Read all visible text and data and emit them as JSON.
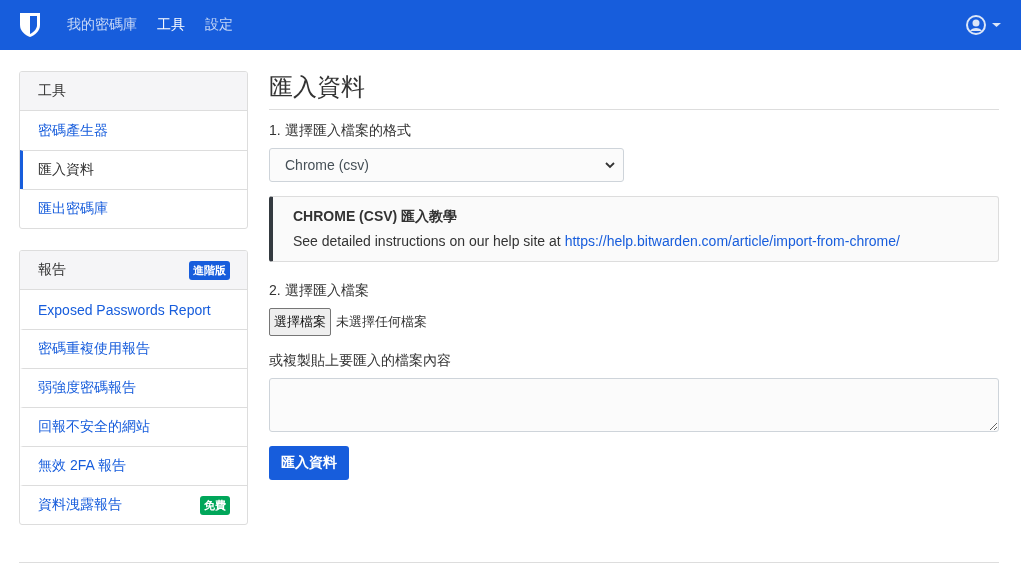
{
  "navbar": {
    "items": [
      {
        "label": "我的密碼庫",
        "selected": false
      },
      {
        "label": "工具",
        "selected": true
      },
      {
        "label": "設定",
        "selected": false
      }
    ]
  },
  "sidebar": [
    {
      "title": "工具",
      "items": [
        {
          "label": "密碼產生器",
          "selected": false
        },
        {
          "label": "匯入資料",
          "selected": true
        },
        {
          "label": "匯出密碼庫",
          "selected": false
        }
      ]
    },
    {
      "title": "報告",
      "badge": {
        "label": "進階版",
        "color": "#175ddc"
      },
      "items": [
        {
          "label": "Exposed Passwords Report",
          "selected": false
        },
        {
          "label": "密碼重複使用報告",
          "selected": false
        },
        {
          "label": "弱強度密碼報告",
          "selected": false
        },
        {
          "label": "回報不安全的網站",
          "selected": false
        },
        {
          "label": "無效 2FA 報告",
          "selected": false
        },
        {
          "label": "資料洩露報告",
          "selected": false,
          "badge": {
            "label": "免費",
            "color": "#00a65a"
          }
        }
      ]
    }
  ],
  "main": {
    "title": "匯入資料",
    "format_label": "1. 選擇匯入檔案的格式",
    "format_value": "Chrome (csv)",
    "callout": {
      "title": "CHROME (CSV) 匯入教學",
      "text": "See detailed instructions on our help site at",
      "link": "https://help.bitwarden.com/article/import-from-chrome/"
    },
    "file_label": "2. 選擇匯入檔案",
    "file_button": "選擇檔案",
    "file_status": "未選擇任何檔案",
    "paste_label": "或複製貼上要匯入的檔案內容",
    "submit": "匯入資料"
  }
}
